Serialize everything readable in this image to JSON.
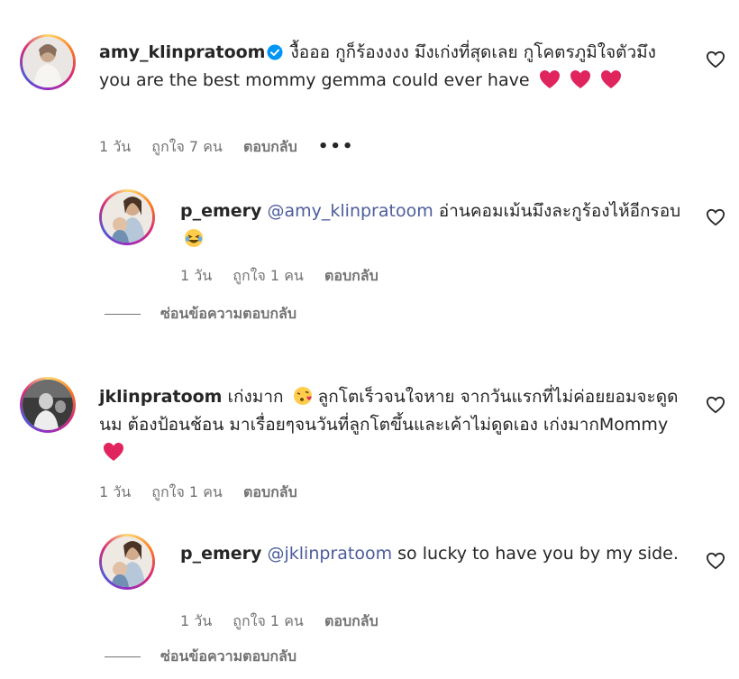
{
  "comments": [
    {
      "username": "amy_klinpratoom",
      "verified": true,
      "text": "งื้อออ กูก็ร้องงงง มึงเก่งที่สุดเลย กูโคตรภูมิใจตัวมึง you are the best mommy gemma could ever have",
      "time": "1 วัน",
      "likes": "ถูกใจ 7 คน",
      "reply": "ตอบกลับ",
      "more": "•••",
      "reply_thread": {
        "username": "p_emery",
        "mention": "@amy_klinpratoom",
        "text": "อ่านคอมเม้นมึงละกูร้องไห้อีกรอบ",
        "time": "1 วัน",
        "likes": "ถูกใจ 1 คน",
        "reply": "ตอบกลับ"
      },
      "hide_replies": "ซ่อนข้อความตอบกลับ"
    },
    {
      "username": "jklinpratoom",
      "text_a": "เก่งมาก",
      "text_b": "ลูกโตเร็วจนใจหาย จากวันแรกที่ไม่ค่อยยอมจะดูดนม ต้องป้อนช้อน มาเรื่อยๆจนวันที่ลูกโตขึ้นและเค้าไม่ดูดเอง เก่งมากMommy",
      "time": "1 วัน",
      "likes": "ถูกใจ 1 คน",
      "reply": "ตอบกลับ",
      "reply_thread": {
        "username": "p_emery",
        "mention": "@jklinpratoom",
        "text": "so lucky to have you by my side.",
        "time": "1 วัน",
        "likes": "ถูกใจ 1 คน",
        "reply": "ตอบกลับ"
      },
      "hide_replies": "ซ่อนข้อความตอบกลับ"
    }
  ],
  "colors": {
    "text": "#262626",
    "secondary": "#737373",
    "mention": "#4d5d9c",
    "verified": "#0095f6",
    "heart_emoji": "#e0245e"
  }
}
